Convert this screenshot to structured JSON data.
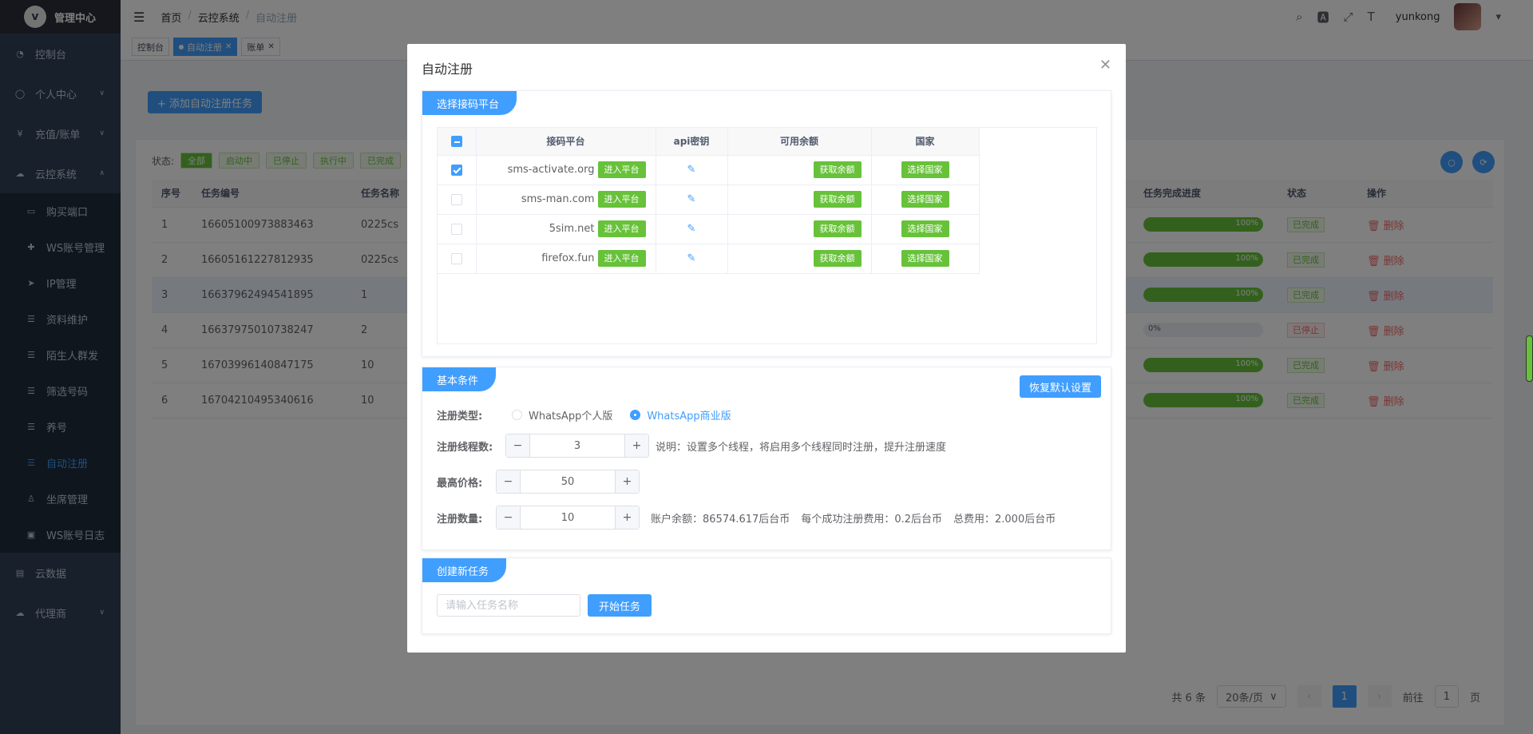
{
  "app": {
    "title": "管理中心",
    "logo_icon": "logo-icon"
  },
  "sidebar": {
    "items": [
      {
        "label": "控制台",
        "icon": "dashboard-icon"
      },
      {
        "label": "个人中心",
        "icon": "user-icon"
      },
      {
        "label": "充值/账单",
        "icon": "yen-icon"
      },
      {
        "label": "云控系统",
        "icon": "cloud-icon"
      }
    ],
    "sub_items": [
      {
        "label": "购买端口"
      },
      {
        "label": "WS账号管理"
      },
      {
        "label": "IP管理"
      },
      {
        "label": "资料维护"
      },
      {
        "label": "陌生人群发"
      },
      {
        "label": "筛选号码"
      },
      {
        "label": "养号"
      },
      {
        "label": "自动注册"
      },
      {
        "label": "坐席管理"
      },
      {
        "label": "WS账号日志"
      }
    ],
    "bottom_items": [
      {
        "label": "云数据"
      },
      {
        "label": "代理商"
      }
    ]
  },
  "header": {
    "breadcrumb": [
      "首页",
      "云控系统",
      "自动注册"
    ],
    "username": "yunkong"
  },
  "tags": [
    {
      "label": "控制台"
    },
    {
      "label": "自动注册"
    },
    {
      "label": "账单"
    }
  ],
  "main": {
    "add_button": "+ 添加自动注册任务",
    "status_label": "状态:",
    "status_filters": [
      "全部",
      "启动中",
      "已停止",
      "执行中",
      "已完成"
    ],
    "columns": [
      "序号",
      "任务编号",
      "任务名称",
      "任务完成进度",
      "状态",
      "操作"
    ],
    "rows": [
      {
        "idx": "1",
        "id": "16605100973883463",
        "name": "0225cs",
        "progress": 100,
        "progress_text": "100%",
        "status": "已完成",
        "action": "删除"
      },
      {
        "idx": "2",
        "id": "16605161227812935",
        "name": "0225cs",
        "progress": 100,
        "progress_text": "100%",
        "status": "已完成",
        "action": "删除"
      },
      {
        "idx": "3",
        "id": "16637962494541895",
        "name": "1",
        "progress": 100,
        "progress_text": "100%",
        "status": "已完成",
        "action": "删除"
      },
      {
        "idx": "4",
        "id": "16637975010738247",
        "name": "2",
        "progress": 0,
        "progress_text": "0%",
        "status": "已停止",
        "action": "删除"
      },
      {
        "idx": "5",
        "id": "16703996140847175",
        "name": "10",
        "progress": 100,
        "progress_text": "100%",
        "status": "已完成",
        "action": "删除"
      },
      {
        "idx": "6",
        "id": "16704210495340616",
        "name": "10",
        "progress": 100,
        "progress_text": "100%",
        "status": "已完成",
        "action": "删除"
      }
    ],
    "pager": {
      "total": "共 6 条",
      "page_size": "20条/页",
      "current": "1",
      "goto_label": "前往",
      "goto_value": "1",
      "page_suffix": "页"
    }
  },
  "dialog": {
    "title": "自动注册",
    "section1": {
      "ribbon": "选择接码平台",
      "columns": [
        "接码平台",
        "api密钥",
        "可用余额",
        "国家"
      ],
      "enter_label": "进入平台",
      "balance_label": "获取余额",
      "country_label": "选择国家",
      "platforms": [
        {
          "name": "sms-activate.org",
          "checked": true
        },
        {
          "name": "sms-man.com",
          "checked": false
        },
        {
          "name": "5sim.net",
          "checked": false
        },
        {
          "name": "firefox.fun",
          "checked": false
        }
      ]
    },
    "section2": {
      "ribbon": "基本条件",
      "restore_button": "恢复默认设置",
      "reg_type_label": "注册类型:",
      "reg_type_options": [
        "WhatsApp个人版",
        "WhatsApp商业版"
      ],
      "reg_type_selected": "WhatsApp商业版",
      "threads_label": "注册线程数:",
      "threads_value": "3",
      "threads_note": "说明：设置多个线程，将启用多个线程同时注册，提升注册速度",
      "price_label": "最高价格:",
      "price_value": "50",
      "count_label": "注册数量:",
      "count_value": "10",
      "balance_text": "账户余额：86574.617后台币",
      "fee_text": "每个成功注册费用：0.2后台币",
      "total_text": "总费用：2.000后台币"
    },
    "section3": {
      "ribbon": "创建新任务",
      "input_placeholder": "请输入任务名称",
      "start_button": "开始任务"
    }
  },
  "colors": {
    "primary": "#409eff",
    "success": "#67c23a",
    "danger": "#f56c6c",
    "sidebar": "#304156"
  }
}
